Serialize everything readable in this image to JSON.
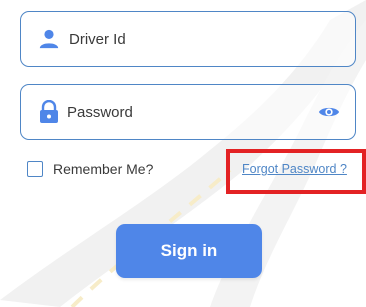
{
  "form": {
    "driver_id": {
      "placeholder": "Driver Id",
      "icon": "person-icon"
    },
    "password": {
      "placeholder": "Password",
      "icon": "lock-icon",
      "toggle_icon": "eye-icon"
    },
    "remember_label": "Remember Me?",
    "forgot_label": "Forgot Password ?",
    "signin_label": "Sign in"
  },
  "colors": {
    "accent": "#4f86c6",
    "button": "#4f86e8",
    "highlight": "#e32224",
    "text": "#3a3a3a"
  }
}
